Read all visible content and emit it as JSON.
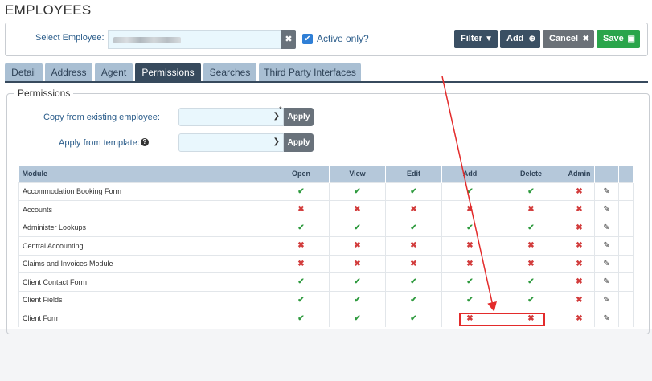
{
  "page": {
    "title": "EMPLOYEES"
  },
  "employee_bar": {
    "select_label": "Select Employee:",
    "selected_value": "",
    "active_only_label": "Active only?",
    "active_only_checked": true
  },
  "toolbar": {
    "filter_label": "Filter",
    "add_label": "Add",
    "cancel_label": "Cancel",
    "save_label": "Save",
    "filter_icon": "funnel-icon",
    "add_icon": "plus-circle-icon",
    "cancel_icon": "close-icon",
    "save_icon": "floppy-disk-icon"
  },
  "tabs": [
    {
      "label": "Detail",
      "active": false
    },
    {
      "label": "Address",
      "active": false
    },
    {
      "label": "Agent",
      "active": false
    },
    {
      "label": "Permissions",
      "active": true
    },
    {
      "label": "Searches",
      "active": false
    },
    {
      "label": "Third Party Interfaces",
      "active": false
    }
  ],
  "permissions": {
    "legend": "Permissions",
    "copy_label": "Copy from existing employee:",
    "copy_value": "",
    "copy_required_mark": "*",
    "template_label": "Apply from template:",
    "template_value": "",
    "apply_label": "Apply",
    "help_icon": "question-circle-icon"
  },
  "grid": {
    "columns": [
      "Module",
      "Open",
      "View",
      "Edit",
      "Add",
      "Delete",
      "Admin",
      ""
    ],
    "rows": [
      {
        "module": "Accommodation Booking Form",
        "perms": [
          true,
          true,
          true,
          true,
          true,
          false
        ]
      },
      {
        "module": "Accounts",
        "perms": [
          false,
          false,
          false,
          false,
          false,
          false
        ]
      },
      {
        "module": "Administer Lookups",
        "perms": [
          true,
          true,
          true,
          true,
          true,
          false
        ]
      },
      {
        "module": "Central Accounting",
        "perms": [
          false,
          false,
          false,
          false,
          false,
          false
        ]
      },
      {
        "module": "Claims and Invoices Module",
        "perms": [
          false,
          false,
          false,
          false,
          false,
          false
        ]
      },
      {
        "module": "Client Contact Form",
        "perms": [
          true,
          true,
          true,
          true,
          true,
          false
        ]
      },
      {
        "module": "Client Fields",
        "perms": [
          true,
          true,
          true,
          true,
          true,
          false
        ]
      },
      {
        "module": "Client Form",
        "perms": [
          true,
          true,
          true,
          false,
          false,
          false
        ]
      }
    ],
    "check_symbol": "✔",
    "cross_symbol": "✖",
    "edit_icon": "pencil-icon",
    "colors": {
      "check": "#2e9a3e",
      "cross": "#d23c3c",
      "header": "#b5c8da"
    }
  },
  "annotation": {
    "color": "#e32b2b"
  }
}
